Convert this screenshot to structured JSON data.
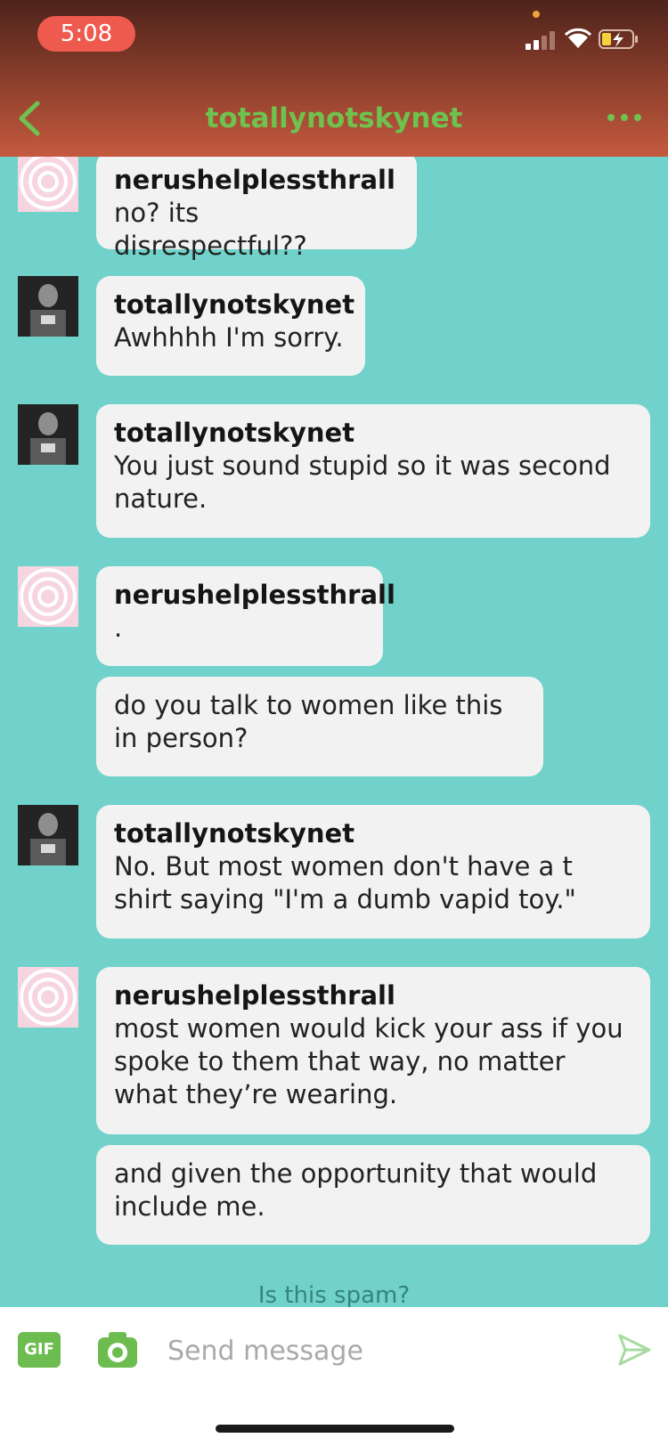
{
  "status_bar": {
    "time": "5:08",
    "icons": [
      "signal-icon",
      "wifi-icon",
      "battery-charging-icon"
    ]
  },
  "header": {
    "title": "totallynotskynet",
    "back_icon": "chevron-left-icon",
    "more_icon": "more-dots-icon"
  },
  "messages": [
    {
      "sender": "nerushelplessthrall",
      "avatar": "spiral-avatar",
      "text": "no? its disrespectful??"
    },
    {
      "sender": "totallynotskynet",
      "avatar": "photo-avatar",
      "text": "Awhhhh I'm sorry."
    },
    {
      "sender": "totallynotskynet",
      "avatar": "photo-avatar",
      "text": "You just sound stupid so it was second nature."
    },
    {
      "sender": "nerushelplessthrall",
      "avatar": "spiral-avatar",
      "text": "."
    },
    {
      "sender": "",
      "avatar": "",
      "text": "do you talk to women like this in person?"
    },
    {
      "sender": "totallynotskynet",
      "avatar": "photo-avatar",
      "text": "No.  But most women don't have a t shirt saying \"I'm a dumb vapid toy.\""
    },
    {
      "sender": "nerushelplessthrall",
      "avatar": "spiral-avatar",
      "text": "most women would kick your ass if you spoke to them that way, no matter what they’re wearing."
    },
    {
      "sender": "",
      "avatar": "",
      "text": "and given the opportunity that would include me."
    }
  ],
  "spam_link": "Is this spam?",
  "composer": {
    "gif_label": "GIF",
    "placeholder": "Send message",
    "camera_icon": "camera-icon",
    "send_icon": "send-icon"
  },
  "colors": {
    "accent": "#6fc24e",
    "chat_background": "#70d2ca",
    "bubble": "#f2f2f2"
  }
}
